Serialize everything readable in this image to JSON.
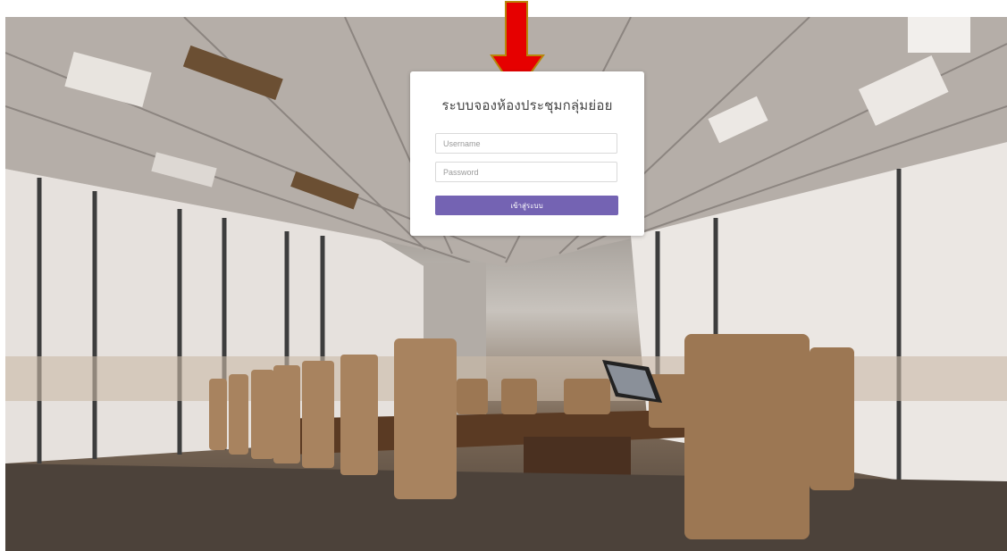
{
  "login": {
    "title": "ระบบจองห้องประชุมกลุ่มย่อย",
    "username_placeholder": "Username",
    "password_placeholder": "Password",
    "submit_label": "เข้าสู่ระบบ"
  },
  "colors": {
    "button": "#7463b3",
    "arrow": "#e60000",
    "arrow_outline": "#b8860b"
  },
  "icons": {
    "annotation": "down-arrow-icon"
  }
}
